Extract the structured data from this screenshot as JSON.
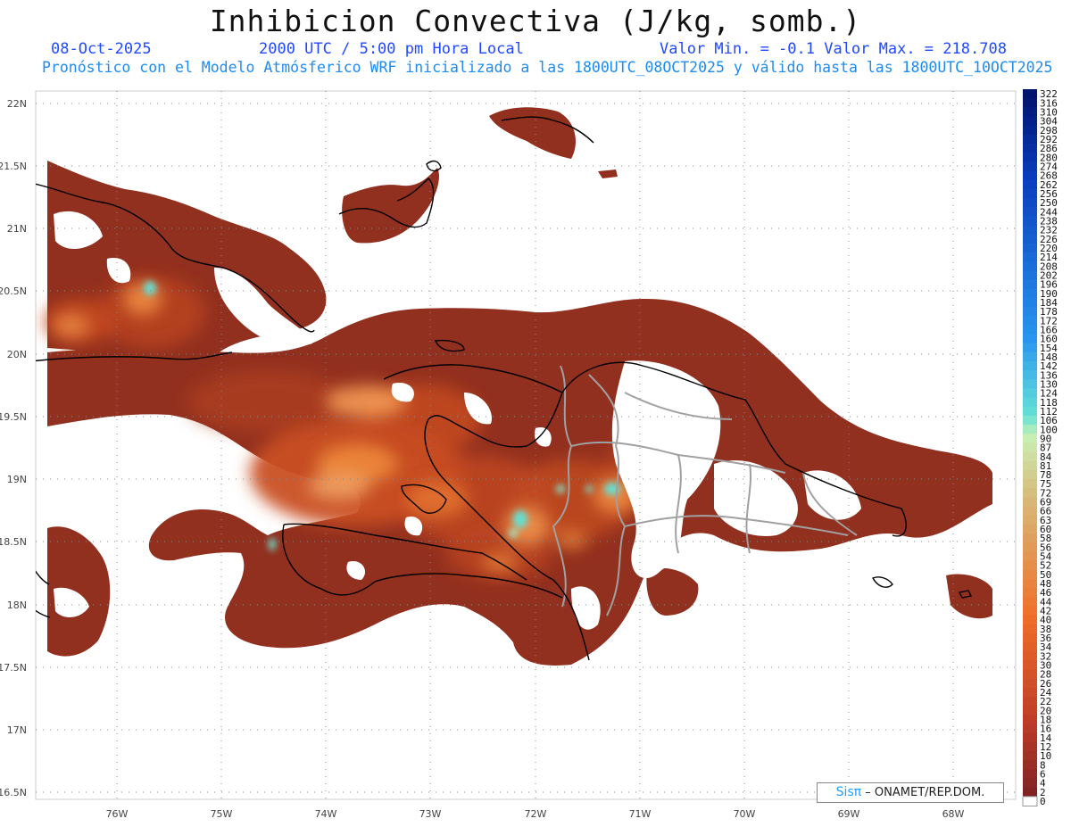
{
  "header": {
    "title": "Inhibicion Convectiva (J/kg, somb.)",
    "date": "08-Oct-2025",
    "time": "2000 UTC / 5:00 pm Hora Local",
    "range": "Valor Min. = -0.1  Valor Max. = 218.708",
    "description": "Pronóstico con el Modelo Atmósferico WRF inicializado a las 1800UTC_08OCT2025 y válido hasta las  1800UTC_10OCT2025"
  },
  "axes": {
    "lat_labels": [
      "22N",
      "21.5N",
      "21N",
      "20.5N",
      "20N",
      "19.5N",
      "19N",
      "18.5N",
      "18N",
      "17.5N",
      "17N",
      "16.5N"
    ],
    "lon_labels": [
      "76W",
      "75W",
      "74W",
      "73W",
      "72W",
      "71W",
      "70W",
      "69W",
      "68W"
    ]
  },
  "colorbar": {
    "labels": [
      "322",
      "316",
      "310",
      "304",
      "298",
      "292",
      "286",
      "280",
      "274",
      "268",
      "262",
      "256",
      "250",
      "244",
      "238",
      "232",
      "226",
      "220",
      "214",
      "208",
      "202",
      "196",
      "190",
      "184",
      "178",
      "172",
      "166",
      "160",
      "154",
      "148",
      "142",
      "136",
      "130",
      "124",
      "118",
      "112",
      "106",
      "100",
      "90",
      "87",
      "84",
      "81",
      "78",
      "75",
      "72",
      "69",
      "66",
      "63",
      "60",
      "58",
      "56",
      "54",
      "52",
      "50",
      "48",
      "46",
      "44",
      "42",
      "40",
      "38",
      "36",
      "34",
      "32",
      "30",
      "28",
      "26",
      "24",
      "22",
      "20",
      "18",
      "16",
      "14",
      "12",
      "10",
      "8",
      "6",
      "4",
      "2",
      "0"
    ]
  },
  "credit": {
    "logo": "Sisπ",
    "text": " – ONAMET/REP.DOM."
  },
  "colors": {
    "cin_base": "#92301f",
    "cin_mid": "#c54a22",
    "cin_high": "#ec7a2a",
    "cin_peak": "#f5b57a",
    "cyan": "#5fe3d8",
    "border": "#999999",
    "coast": "#000000"
  }
}
